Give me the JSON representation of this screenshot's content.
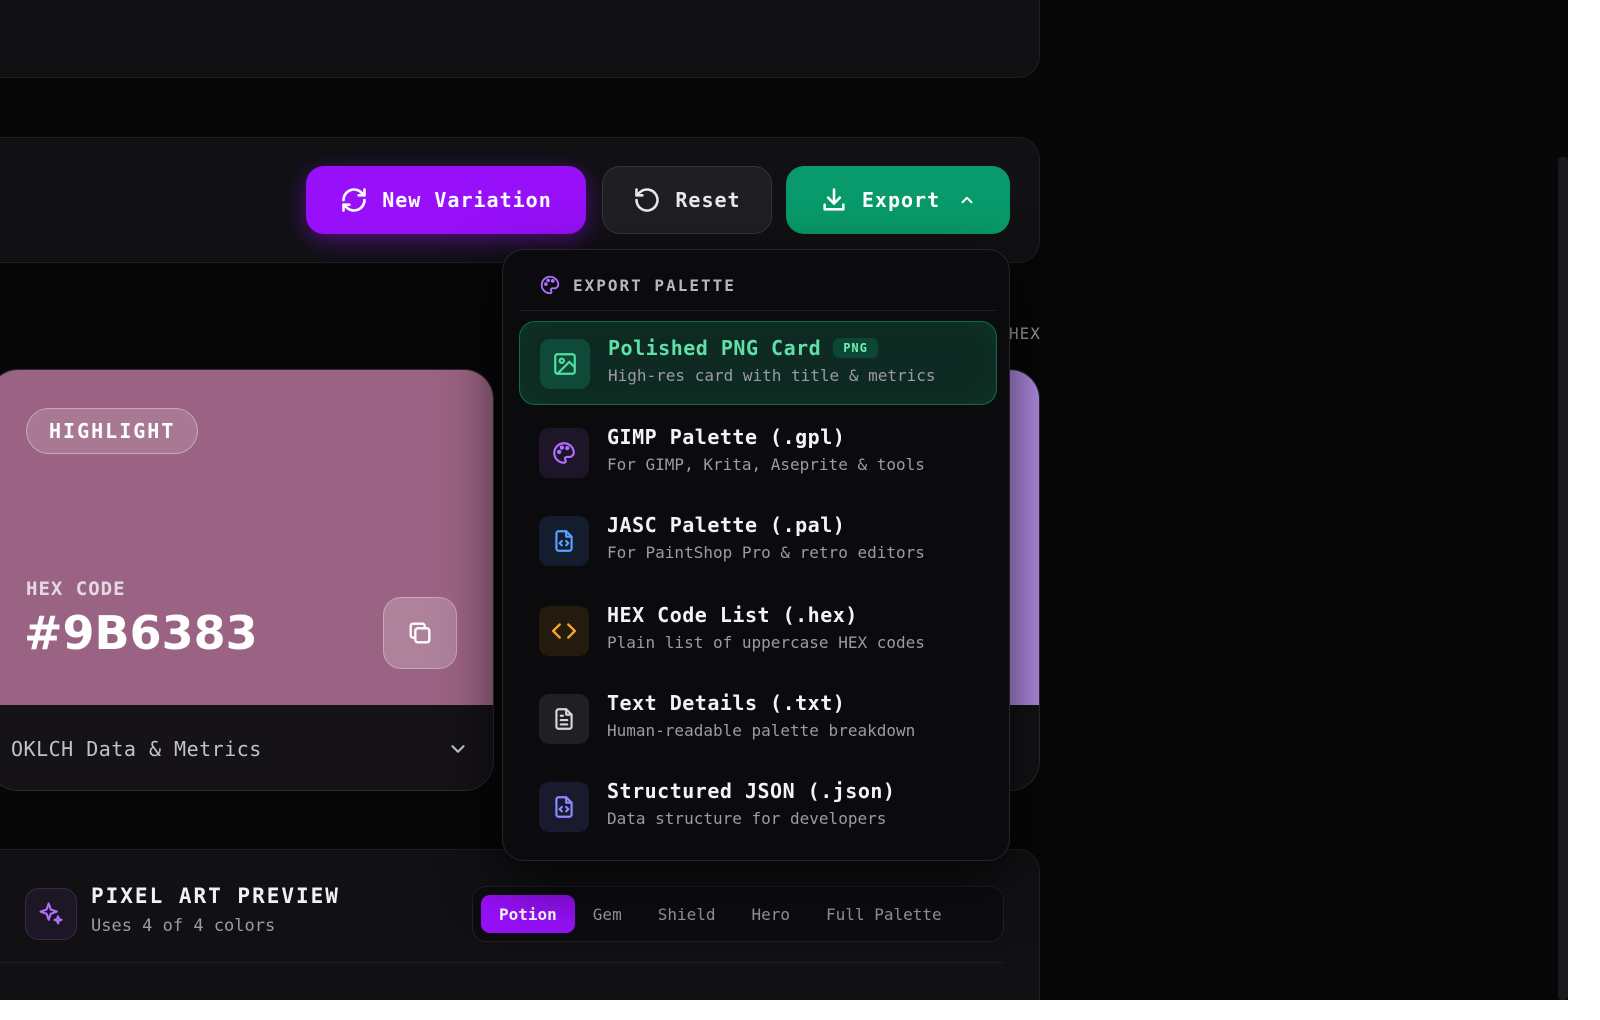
{
  "toolbar": {
    "new_variation_label": "New Variation",
    "reset_label": "Reset",
    "export_label": "Export"
  },
  "color_card": {
    "role": "HIGHLIGHT",
    "hex_label": "HEX CODE",
    "hex_value": "#9B6383",
    "swatch_color": "#9b6383",
    "metrics_label": "OKLCH Data & Metrics"
  },
  "next_card": {
    "hex_label_fragment": "HEX",
    "swatch_color": "#b58ee8"
  },
  "export_menu": {
    "title": "EXPORT PALETTE",
    "options": [
      {
        "title": "Polished PNG Card",
        "badge": "PNG",
        "desc": "High-res card with title & metrics",
        "icon": "image-icon",
        "selected": true
      },
      {
        "title": "GIMP Palette (.gpl)",
        "desc": "For GIMP, Krita, Aseprite & tools",
        "icon": "palette-icon"
      },
      {
        "title": "JASC Palette (.pal)",
        "desc": "For PaintShop Pro & retro editors",
        "icon": "file-code-icon"
      },
      {
        "title": "HEX Code List (.hex)",
        "desc": "Plain list of uppercase HEX codes",
        "icon": "code-icon"
      },
      {
        "title": "Text Details (.txt)",
        "desc": "Human-readable palette breakdown",
        "icon": "file-text-icon"
      },
      {
        "title": "Structured JSON (.json)",
        "desc": "Data structure for developers",
        "icon": "file-json-icon"
      }
    ]
  },
  "pixel_preview": {
    "title": "PIXEL ART PREVIEW",
    "subtitle": "Uses 4 of 4 colors",
    "tabs": [
      "Potion",
      "Gem",
      "Shield",
      "Hero",
      "Full Palette"
    ],
    "active_tab": "Potion"
  },
  "colors": {
    "accent_purple": "#9810fa",
    "accent_green": "#089a6a"
  }
}
